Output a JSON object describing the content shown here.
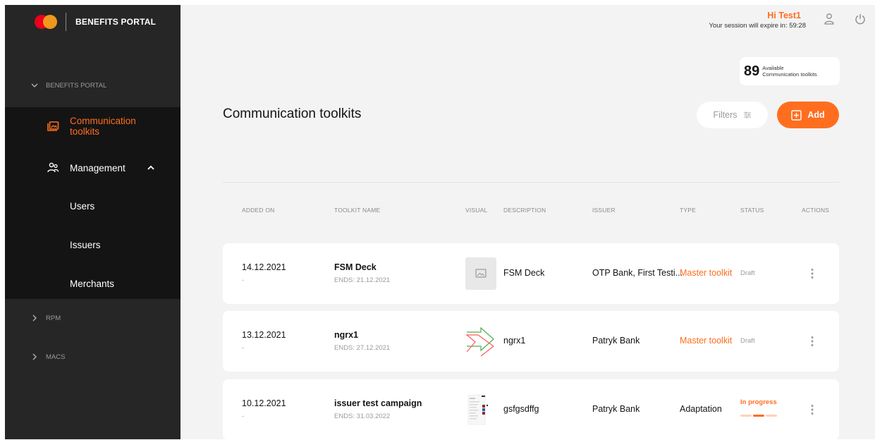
{
  "sidebar": {
    "brand": "BENEFITS PORTAL",
    "section_benefits": "BENEFITS PORTAL",
    "active_item": "Communication toolkits",
    "management": "Management",
    "sub_items": [
      "Users",
      "Issuers",
      "Merchants"
    ],
    "section_rpm": "RPM",
    "section_macs": "MACS"
  },
  "header": {
    "greeting": "Hi Test1",
    "session": "Your session will expire in: 59:28"
  },
  "available": {
    "count": "89",
    "label_line1": "Available",
    "label_line2": "Communication toolkits"
  },
  "page": {
    "title": "Communication toolkits",
    "filters_label": "Filters",
    "add_label": "Add"
  },
  "table": {
    "columns": [
      "ADDED ON",
      "TOOLKIT NAME",
      "VISUAL",
      "DESCRIPTION",
      "ISSUER",
      "TYPE",
      "STATUS",
      "ACTIONS"
    ],
    "rows": [
      {
        "added_on": "14.12.2021",
        "added_sub": "-",
        "name": "FSM Deck",
        "ends": "ENDS: 21.12.2021",
        "visual": "image-placeholder-icon",
        "description": "FSM Deck",
        "issuer": "OTP Bank, First Testi...",
        "type": "Master toolkit",
        "status": "Draft"
      },
      {
        "added_on": "13.12.2021",
        "added_sub": "-",
        "name": "ngrx1",
        "ends": "ENDS: 27.12.2021",
        "visual": "arrow-graphic",
        "description": "ngrx1",
        "issuer": "Patryk Bank",
        "type": "Master toolkit",
        "status": "Draft"
      },
      {
        "added_on": "10.12.2021",
        "added_sub": "-",
        "name": "issuer test campaign",
        "ends": "ENDS: 31.03.2022",
        "visual": "document-thumbnail",
        "description": "gsfgsdffg",
        "issuer": "Patryk Bank",
        "type": "Adaptation",
        "status": "In progress"
      }
    ]
  },
  "colors": {
    "accent": "#ff6e1f",
    "sidebar_bg": "#262626",
    "sidebar_expanded_bg": "#141414",
    "main_bg": "#f3f3f3"
  }
}
